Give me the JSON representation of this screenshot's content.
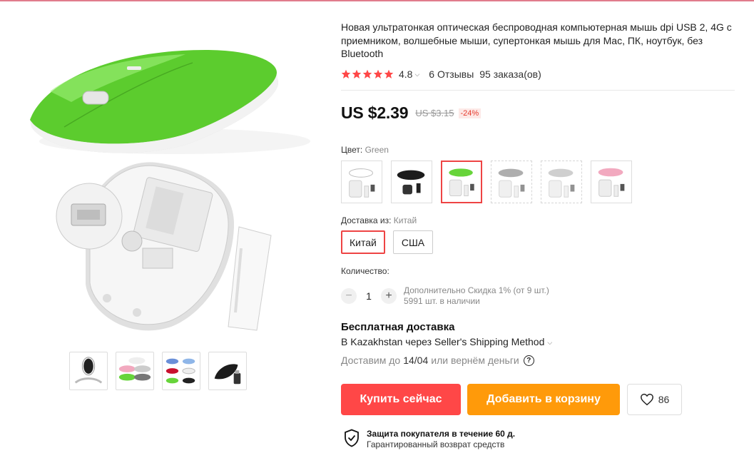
{
  "product": {
    "title": "Новая ультратонкая оптическая беспроводная компьютерная мышь dpi USB 2, 4G с приемником, волшебные мыши, супертонкая мышь для Mac, ПК, ноутбук, без Bluetooth",
    "rating": "4.8",
    "stars": 5,
    "reviews": "6 Отзывы",
    "orders": "95 заказа(ов)"
  },
  "price": {
    "current": "US $2.39",
    "old": "US $3.15",
    "discount": "-24%"
  },
  "color": {
    "label": "Цвет:",
    "selected": "Green",
    "options": [
      "white",
      "black",
      "green",
      "gray",
      "silver",
      "pink"
    ],
    "selected_index": 2,
    "swatch_colors": [
      "#ffffff",
      "#1c1c1c",
      "#67d43a",
      "#9a9a9a",
      "#c4c4c4",
      "#f2a9bf"
    ]
  },
  "shipping_from": {
    "label": "Доставка из:",
    "selected": "Китай",
    "options": [
      "Китай",
      "США"
    ]
  },
  "quantity": {
    "label": "Количество:",
    "value": "1",
    "discount_note": "Дополнительно Скидка 1% (от 9 шт.)",
    "stock": "5991 шт. в наличии"
  },
  "delivery": {
    "title": "Бесплатная доставка",
    "method": "В Kazakhstan через Seller's Shipping Method",
    "eta_prefix": "Доставим до",
    "eta_date": "14/04",
    "eta_suffix": "или вернём деньги"
  },
  "actions": {
    "buy": "Купить сейчас",
    "cart": "Добавить в корзину",
    "wishlist_count": "86"
  },
  "protection": {
    "title": "Защита покупателя в течение 60 д.",
    "subtitle": "Гарантированный возврат средств"
  },
  "colors": {
    "accent_red": "#ff4747",
    "accent_orange": "#ff9a0a",
    "star": "#ff4747",
    "product_green": "#67d43a"
  }
}
